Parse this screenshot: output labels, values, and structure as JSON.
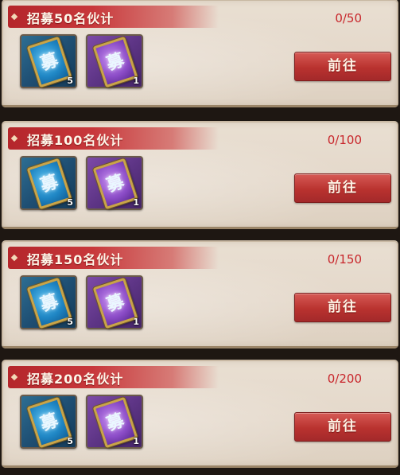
{
  "tasks": [
    {
      "title": "招募50名伙计",
      "progress": "0/50",
      "button_label": "前往",
      "rewards": [
        {
          "icon": "blue-recruit-card-icon",
          "count": "5"
        },
        {
          "icon": "purple-recruit-card-icon",
          "count": "1"
        }
      ]
    },
    {
      "title": "招募100名伙计",
      "progress": "0/100",
      "button_label": "前往",
      "rewards": [
        {
          "icon": "blue-recruit-card-icon",
          "count": "5"
        },
        {
          "icon": "purple-recruit-card-icon",
          "count": "1"
        }
      ]
    },
    {
      "title": "招募150名伙计",
      "progress": "0/150",
      "button_label": "前往",
      "rewards": [
        {
          "icon": "blue-recruit-card-icon",
          "count": "5"
        },
        {
          "icon": "purple-recruit-card-icon",
          "count": "1"
        }
      ]
    },
    {
      "title": "招募200名伙计",
      "progress": "0/200",
      "button_label": "前往",
      "rewards": [
        {
          "icon": "blue-recruit-card-icon",
          "count": "5"
        },
        {
          "icon": "purple-recruit-card-icon",
          "count": "1"
        }
      ]
    }
  ],
  "colors": {
    "ribbon": "#c8383b",
    "progress_text": "#c8262b",
    "button": "#b9322f",
    "panel": "#e6dbcd"
  }
}
